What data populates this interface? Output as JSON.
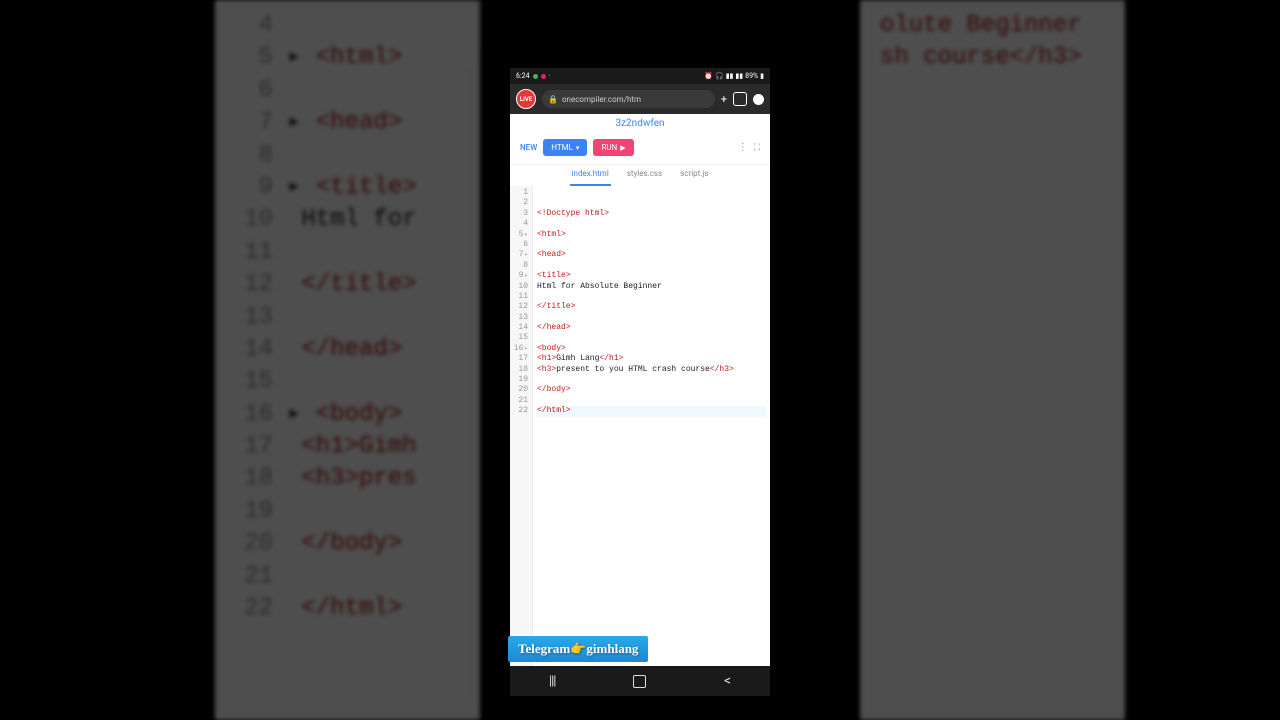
{
  "statusbar": {
    "time": "6:24",
    "battery": "89%"
  },
  "browser": {
    "avatar_label": "LIVE",
    "url": "onecompiler.com/htm"
  },
  "project": {
    "name": "3z2ndwfen"
  },
  "toolbar": {
    "new_label": "NEW",
    "html_label": "HTML",
    "run_label": "RUN"
  },
  "filetabs": {
    "index": "index.html",
    "styles": "styles.css",
    "script": "script.js"
  },
  "code": {
    "lines": [
      {
        "n": "1",
        "fold": false,
        "html": ""
      },
      {
        "n": "2",
        "fold": false,
        "html": ""
      },
      {
        "n": "3",
        "fold": false,
        "html": "<span class='t-tag'>&lt;!Doctype html&gt;</span>"
      },
      {
        "n": "4",
        "fold": false,
        "html": ""
      },
      {
        "n": "5",
        "fold": true,
        "html": "<span class='t-tag'>&lt;html&gt;</span>"
      },
      {
        "n": "6",
        "fold": false,
        "html": ""
      },
      {
        "n": "7",
        "fold": true,
        "html": "<span class='t-tag'>&lt;head&gt;</span>"
      },
      {
        "n": "8",
        "fold": false,
        "html": ""
      },
      {
        "n": "9",
        "fold": true,
        "html": "<span class='t-tag'>&lt;title&gt;</span>"
      },
      {
        "n": "10",
        "fold": false,
        "html": "<span class='t-txt'>Html for Absolute Beginner</span>"
      },
      {
        "n": "11",
        "fold": false,
        "html": ""
      },
      {
        "n": "12",
        "fold": false,
        "html": "<span class='t-tag'>&lt;/title&gt;</span>"
      },
      {
        "n": "13",
        "fold": false,
        "html": ""
      },
      {
        "n": "14",
        "fold": false,
        "html": "<span class='t-tag'>&lt;/head&gt;</span>"
      },
      {
        "n": "15",
        "fold": false,
        "html": ""
      },
      {
        "n": "16",
        "fold": true,
        "html": "<span class='t-tag'>&lt;body&gt;</span>"
      },
      {
        "n": "17",
        "fold": false,
        "html": "<span class='t-tag'>&lt;h1&gt;</span><span class='t-txt'>Gimh Lang</span><span class='t-tag'>&lt;/h1&gt;</span>"
      },
      {
        "n": "18",
        "fold": false,
        "html": "<span class='t-tag'>&lt;h3&gt;</span><span class='t-txt'>present to you HTML crash course</span><span class='t-tag'>&lt;/h3&gt;</span>"
      },
      {
        "n": "19",
        "fold": false,
        "html": ""
      },
      {
        "n": "20",
        "fold": false,
        "html": "<span class='t-tag'>&lt;/body&gt;</span>"
      },
      {
        "n": "21",
        "fold": false,
        "html": ""
      },
      {
        "n": "22",
        "fold": false,
        "cursor": true,
        "html": "<span class='t-tag'>&lt;/html&gt;</span>"
      }
    ]
  },
  "banner": {
    "text": "Telegram👉gimhlang"
  },
  "bg_lines": [
    {
      "n": "4",
      "content": ""
    },
    {
      "n": "5",
      "fold": true,
      "content": "<html>"
    },
    {
      "n": "6",
      "content": ""
    },
    {
      "n": "7",
      "fold": true,
      "content": "<head>"
    },
    {
      "n": "8",
      "content": ""
    },
    {
      "n": "9",
      "fold": true,
      "content": "<title>"
    },
    {
      "n": "10",
      "content": "Html for Absolute Beginner",
      "plain": true
    },
    {
      "n": "11",
      "content": ""
    },
    {
      "n": "12",
      "content": "</title>"
    },
    {
      "n": "13",
      "content": ""
    },
    {
      "n": "14",
      "content": "</head>"
    },
    {
      "n": "15",
      "content": ""
    },
    {
      "n": "16",
      "fold": true,
      "content": "<body>"
    },
    {
      "n": "17",
      "content": "<h1>Gimh Lang</h1>",
      "mixed": true
    },
    {
      "n": "18",
      "content": "<h3>present to you HTML crash course</h3>",
      "mixed": true
    },
    {
      "n": "19",
      "content": ""
    },
    {
      "n": "20",
      "content": "</body>"
    },
    {
      "n": "21",
      "content": ""
    },
    {
      "n": "22",
      "content": "</html>"
    }
  ]
}
